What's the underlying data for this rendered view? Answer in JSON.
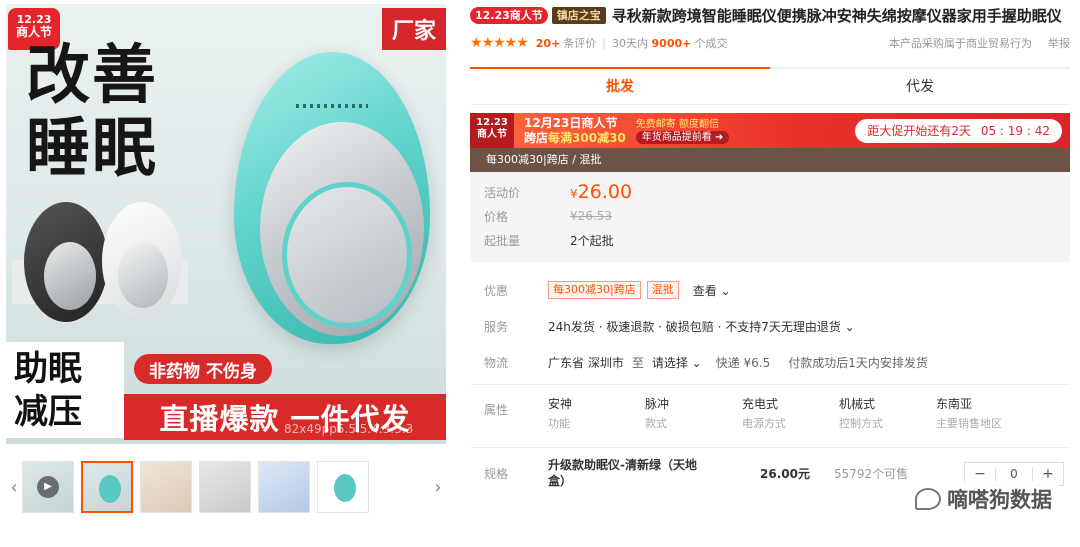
{
  "gallery": {
    "promo_tag_date": "12.23",
    "promo_tag_name": "商人节",
    "factory_label": "厂家",
    "headline": "改善\n睡眠",
    "caption": "助眠\n减压",
    "pill_text": "非药物 不伤身",
    "banner_text": "直播爆款 一件代发",
    "overlay_text": "82x49pp5.5.5.4.3.3.3",
    "thumb_count": 6,
    "prev_arrow": "‹",
    "next_arrow": "›"
  },
  "product": {
    "badge_promo": "12.23商人节",
    "badge_store": "镇店之宝",
    "title": "寻秋新款跨境智能睡眠仪便携脉冲安神失绵按摩仪器家用手握助眠仪",
    "rating_stars": "★★★★★",
    "reviews_count": "20+",
    "reviews_label": "条评价",
    "sales_period": "30天内",
    "sales_count": "9000+",
    "sales_label": "个成交",
    "notice": "本产品采购属于商业贸易行为",
    "report": "举报"
  },
  "tabs": [
    {
      "label": "批发",
      "active": true
    },
    {
      "label": "代发",
      "active": false
    }
  ],
  "promo": {
    "tag_date": "12.23",
    "tag_name": "商人节",
    "title_line1": "12月23日商人节",
    "title_line2_a": "跨店",
    "title_line2_b": "每满300减30",
    "chip1": "免费邮寄 额度翻倍",
    "chip2": "年货商品提前看 ➜",
    "countdown_label": "距大促开始还有2天",
    "countdown_time": "05 : 19 : 42",
    "sub_text": "每300减30|跨店 / 混批"
  },
  "price": {
    "activity_label": "活动价",
    "currency": "¥",
    "activity_value": "26.00",
    "price_label": "价格",
    "original_price": "¥26.53",
    "moq_label": "起批量",
    "moq_value": "2个起批"
  },
  "service": {
    "discount_label": "优惠",
    "discount_chip1": "每300减30|跨店",
    "discount_chip2": "混批",
    "discount_more": "查看 ⌄",
    "service_label": "服务",
    "service_text": "24h发货 · 极速退款 · 破损包赔 · 不支持7天无理由退货 ⌄",
    "logistics_label": "物流",
    "origin": "广东省 深圳市",
    "to": "至",
    "select": "请选择 ⌄",
    "express": "快递  ¥6.5",
    "delivery_note": "付款成功后1天内安排发货"
  },
  "attributes": {
    "label": "属性",
    "items": [
      {
        "value": "安神",
        "key": "功能"
      },
      {
        "value": "脉冲",
        "key": "款式"
      },
      {
        "value": "充电式",
        "key": "电源方式"
      },
      {
        "value": "机械式",
        "key": "控制方式"
      },
      {
        "value": "东南亚",
        "key": "主要销售地区"
      }
    ]
  },
  "spec": {
    "label": "规格",
    "name": "升级款助眠仪-清新绿（天地盒）",
    "price": "26.00元",
    "stock": "55792个可售",
    "minus": "−",
    "qty": "0",
    "plus": "+"
  },
  "watermark": "嘀嗒狗数据",
  "colors": {
    "accent": "#ff5000",
    "promo_red": "#e4262c",
    "banner_red": "#d92a2a",
    "device_teal": "#5fd3cb"
  }
}
